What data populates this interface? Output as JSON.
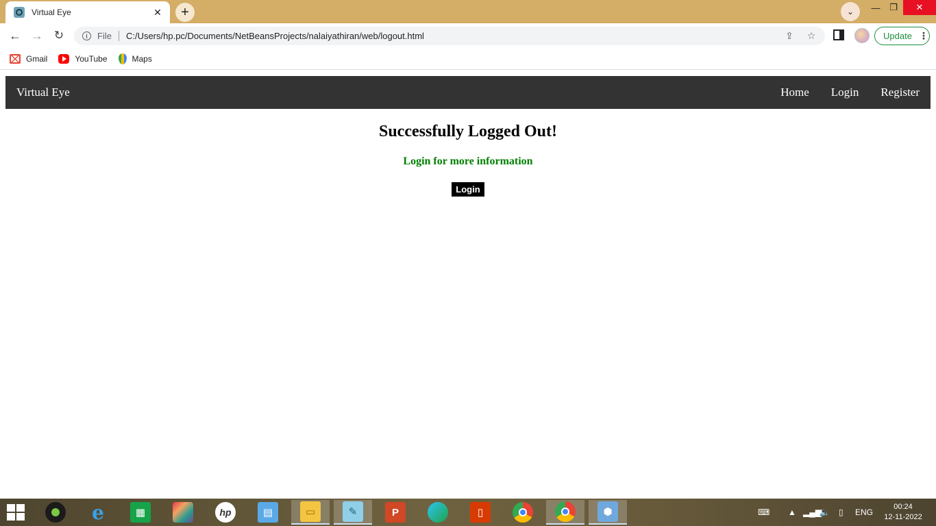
{
  "browser": {
    "tab_title": "Virtual Eye",
    "scheme_label": "File",
    "url": "C:/Users/hp.pc/Documents/NetBeansProjects/nalaiyathiran/web/logout.html",
    "update_label": "Update",
    "bookmarks": [
      {
        "label": "Gmail",
        "icon": "gmail-icon"
      },
      {
        "label": "YouTube",
        "icon": "youtube-icon"
      },
      {
        "label": "Maps",
        "icon": "maps-icon"
      }
    ]
  },
  "site": {
    "brand": "Virtual Eye",
    "nav_links": [
      "Home",
      "Login",
      "Register"
    ],
    "heading": "Successfully Logged Out!",
    "subheading": "Login for more information",
    "login_button": "Login",
    "colors": {
      "navbar": "#333333",
      "subheading": "#008000",
      "button": "#000000"
    }
  },
  "taskbar": {
    "language": "ENG",
    "time": "00:24",
    "date": "12-11-2022",
    "apps": [
      "webcam-icon",
      "internet-explorer-icon",
      "store-icon",
      "photo-app-icon",
      "hp-icon",
      "control-panel-icon",
      "file-explorer-icon",
      "notepad-icon",
      "powerpoint-icon",
      "edge-icon",
      "office-icon",
      "chrome-icon",
      "chrome-active-icon",
      "virtualbox-icon"
    ]
  }
}
